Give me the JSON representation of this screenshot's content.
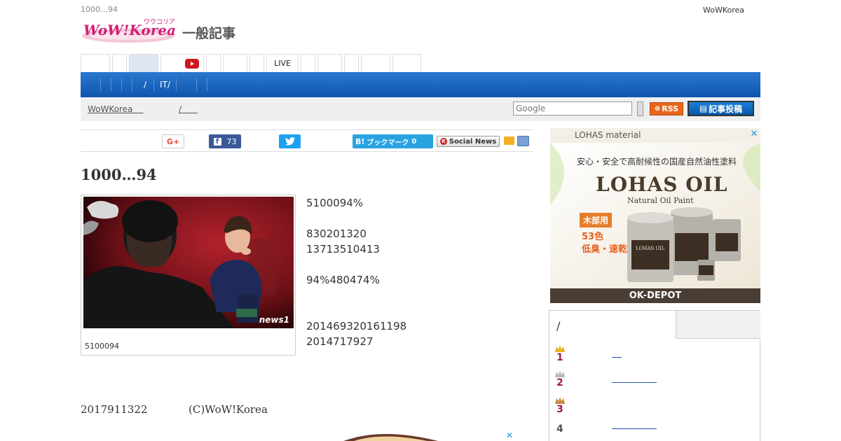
{
  "header": {
    "breadcrumb": "1000…94",
    "brand": "WoWKorea",
    "logo_text": "WoW!Korea",
    "logo_kana": "ワウコリア",
    "section_title": "一般記事"
  },
  "tabs": [
    {
      "label": ""
    },
    {
      "label": ""
    },
    {
      "label": "",
      "active": true
    },
    {
      "label": "",
      "icon": "youtube-icon"
    },
    {
      "label": ""
    },
    {
      "label": ""
    },
    {
      "label": ""
    },
    {
      "label": "LIVE"
    },
    {
      "label": ""
    },
    {
      "label": ""
    },
    {
      "label": ""
    },
    {
      "label": ""
    },
    {
      "label": ""
    }
  ],
  "nav": {
    "items": [
      "",
      "",
      "",
      "/",
      "IT/",
      "",
      "",
      ""
    ]
  },
  "subbar": {
    "crumb1": "WoWKorea",
    "crumb2": "",
    "crumb3": "/",
    "search_placeholder": "Google",
    "rss_label": "RSS",
    "post_label": "記事投稿"
  },
  "share": {
    "gplus_label": "G+",
    "facebook_count": "73",
    "hatena_label": "ブックマーク",
    "hatena_count": "0",
    "hatena_logo": "B!",
    "socialnews_label": "Social News"
  },
  "article": {
    "title": "1000…94",
    "caption": "5100094",
    "body": [
      "5100094%",
      "",
      "830201320",
      "13713510413",
      "",
      "94%480474%",
      "",
      "",
      "201469320161198",
      "2014717927"
    ],
    "date": "2017911322",
    "copyright": "(C)WoW!Korea",
    "photo_watermark": "news1"
  },
  "ad": {
    "brand_bar": "LOHAS material",
    "close": "✕",
    "tagline": "安心・安全で高耐候性の国産自然油性塗料",
    "product": "LOHAS OIL",
    "product_sub": "Natural Oil Paint",
    "badge": "木部用",
    "colors_line1": "53色",
    "colors_line2": "低臭・速乾",
    "can_label": "LOHAS OIL",
    "footer": "OK-DEPOT"
  },
  "ranking": {
    "tab_a": "/",
    "tab_b": "",
    "rows": [
      {
        "rank": "1"
      },
      {
        "rank": "2"
      },
      {
        "rank": "3"
      },
      {
        "rank": "4"
      }
    ]
  },
  "colors": {
    "nav_blue": "#1565c0",
    "rss_orange": "#e8661e",
    "facebook": "#3b5998",
    "twitter": "#1da1f2",
    "hatena": "#29a3e0",
    "rank_pink": "#a0185a",
    "youtube_red": "#cc181e"
  }
}
